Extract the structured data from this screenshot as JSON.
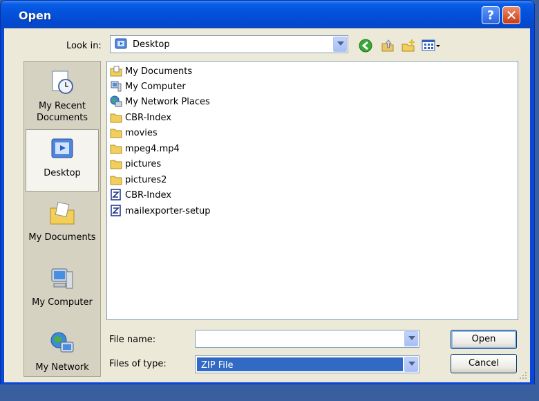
{
  "window": {
    "title": "Open",
    "help_label": "?",
    "close_label": "✕"
  },
  "look_in": {
    "label": "Look in:",
    "value": "Desktop",
    "icon": "desktop-icon"
  },
  "toolbar": {
    "icons": [
      "back-icon",
      "up-folder-icon",
      "new-folder-icon",
      "views-menu-icon"
    ]
  },
  "places": [
    {
      "label": "My Recent Documents",
      "icon": "recent-documents-icon",
      "selected": false
    },
    {
      "label": "Desktop",
      "icon": "desktop-icon",
      "selected": true
    },
    {
      "label": "My Documents",
      "icon": "my-documents-icon",
      "selected": false
    },
    {
      "label": "My Computer",
      "icon": "my-computer-icon",
      "selected": false
    },
    {
      "label": "My Network",
      "icon": "my-network-icon",
      "selected": false
    }
  ],
  "files": [
    {
      "name": "My Documents",
      "icon": "my-documents-icon"
    },
    {
      "name": "My Computer",
      "icon": "my-computer-icon"
    },
    {
      "name": "My Network Places",
      "icon": "network-places-icon"
    },
    {
      "name": "CBR-Index",
      "icon": "folder-icon"
    },
    {
      "name": "movies",
      "icon": "folder-icon"
    },
    {
      "name": "mpeg4.mp4",
      "icon": "folder-icon"
    },
    {
      "name": "pictures",
      "icon": "folder-icon"
    },
    {
      "name": "pictures2",
      "icon": "folder-icon"
    },
    {
      "name": "CBR-Index",
      "icon": "zip-file-icon"
    },
    {
      "name": "mailexporter-setup",
      "icon": "zip-file-icon"
    }
  ],
  "file_name": {
    "label": "File name:",
    "value": ""
  },
  "file_type": {
    "label": "Files of type:",
    "value": "ZIP File"
  },
  "buttons": {
    "open": "Open",
    "cancel": "Cancel"
  },
  "colors": {
    "title_bar": "#0453dc",
    "dialog_bg": "#ece9d8",
    "selection": "#316ac5"
  }
}
